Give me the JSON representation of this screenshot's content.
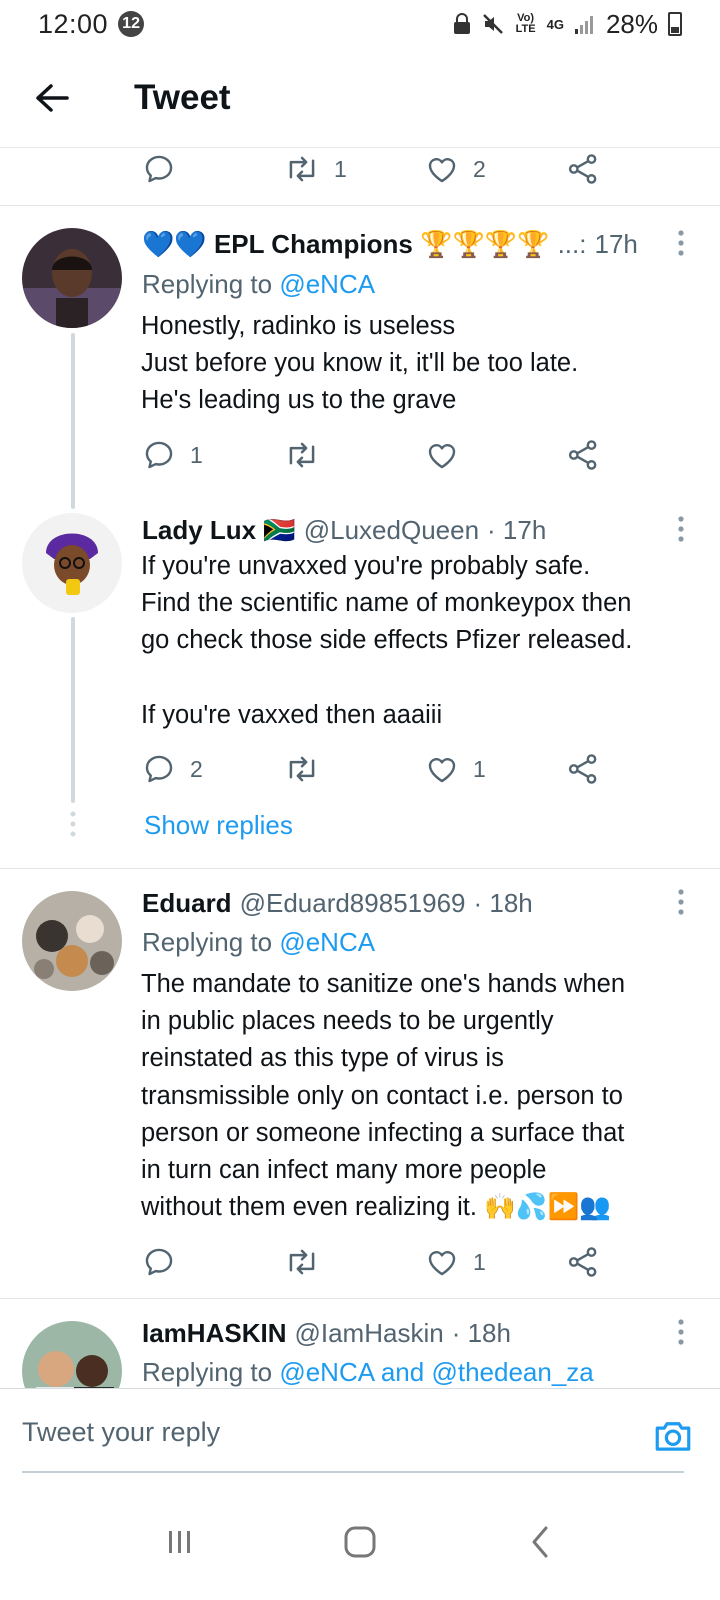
{
  "status_bar": {
    "time": "12:00",
    "notification_count": "12",
    "network": "Vo) LTE",
    "network_type": "4G",
    "battery": "28%"
  },
  "header": {
    "title": "Tweet"
  },
  "top_tweet_actions": {
    "retweets": "1",
    "likes": "2"
  },
  "replies": [
    {
      "display_name": "💙💙 EPL Champions 🏆🏆🏆🏆",
      "handle": "...:",
      "time": "17h",
      "replying_label": "Replying to ",
      "replying_to": "@eNCA",
      "text": "Honestly, radinko is useless\nJust before you know it, it'll be too late.\nHe's leading us to the grave",
      "reply_count": "1",
      "retweet_count": "",
      "like_count": ""
    },
    {
      "display_name": "Lady Lux 🇿🇦",
      "handle": "@LuxedQueen",
      "time": "· 17h",
      "text": "If you're unvaxxed you're probably safe.\nFind the scientific name of monkeypox then\ngo check those side effects Pfizer released.\n\nIf you're vaxxed then aaaiii",
      "reply_count": "2",
      "retweet_count": "",
      "like_count": "1",
      "show_replies": "Show replies"
    },
    {
      "display_name": "Eduard",
      "handle": "@Eduard89851969",
      "time": "· 18h",
      "replying_label": "Replying to ",
      "replying_to": "@eNCA",
      "text": "The mandate to sanitize one's hands when\nin public places needs to be urgently\nreinstated as this type of virus is\ntransmissible only on contact i.e. person to\nperson or someone infecting a surface that\nin turn can infect many more people\nwithout them even realizing it. 🙌💦⏩👥",
      "reply_count": "",
      "retweet_count": "",
      "like_count": "1"
    },
    {
      "display_name": "IamHASKIN",
      "handle": "@IamHaskin",
      "time": "· 18h",
      "replying_label": "Replying to ",
      "replying_to": "@eNCA and @thedean_za"
    }
  ],
  "reply_composer": {
    "placeholder": "Tweet your reply"
  },
  "colors": {
    "accent": "#1d9bf0",
    "secondary_text": "#536471",
    "primary_text": "#0f1419"
  },
  "icons": [
    "back-arrow-icon",
    "reply-icon",
    "retweet-icon",
    "like-icon",
    "share-icon",
    "more-vertical-icon",
    "camera-icon",
    "recent-apps-icon",
    "home-icon",
    "nav-back-icon"
  ]
}
